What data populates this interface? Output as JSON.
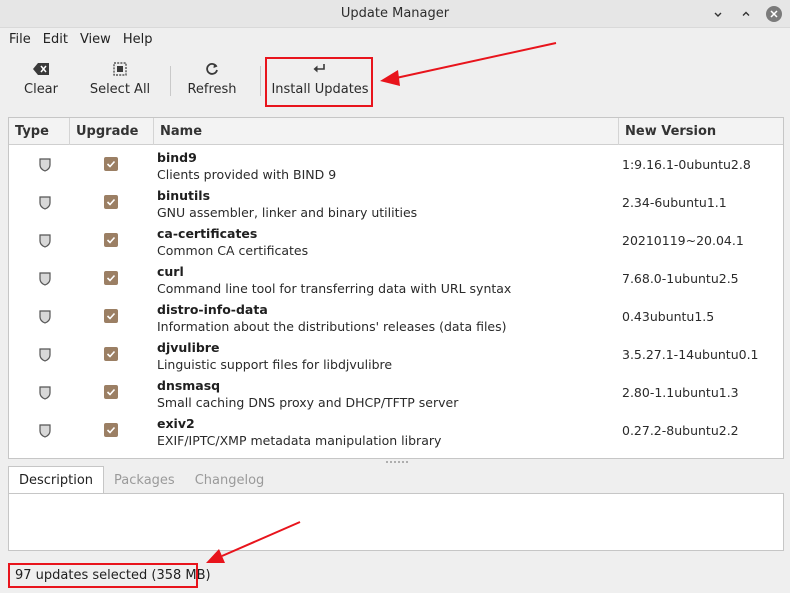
{
  "window": {
    "title": "Update Manager"
  },
  "menu": [
    "File",
    "Edit",
    "View",
    "Help"
  ],
  "toolbar": {
    "clear_label": "Clear",
    "select_all_label": "Select All",
    "refresh_label": "Refresh",
    "install_label": "Install Updates"
  },
  "table": {
    "columns": [
      "Type",
      "Upgrade",
      "Name",
      "New Version"
    ],
    "rows": [
      {
        "name": "bind9",
        "description": "Clients provided with BIND 9",
        "version": "1:9.16.1-0ubuntu2.8"
      },
      {
        "name": "binutils",
        "description": "GNU assembler, linker and binary utilities",
        "version": "2.34-6ubuntu1.1"
      },
      {
        "name": "ca-certificates",
        "description": "Common CA certificates",
        "version": "20210119~20.04.1"
      },
      {
        "name": "curl",
        "description": "Command line tool for transferring data with URL syntax",
        "version": "7.68.0-1ubuntu2.5"
      },
      {
        "name": "distro-info-data",
        "description": "Information about the distributions' releases (data files)",
        "version": "0.43ubuntu1.5"
      },
      {
        "name": "djvulibre",
        "description": "Linguistic support files for libdjvulibre",
        "version": "3.5.27.1-14ubuntu0.1"
      },
      {
        "name": "dnsmasq",
        "description": "Small caching DNS proxy and DHCP/TFTP server",
        "version": "2.80-1.1ubuntu1.3"
      },
      {
        "name": "exiv2",
        "description": "EXIF/IPTC/XMP metadata manipulation library",
        "version": "0.27.2-8ubuntu2.2"
      }
    ]
  },
  "tabs": [
    "Description",
    "Packages",
    "Changelog"
  ],
  "status": {
    "text": "97 updates selected (358 MB)"
  },
  "colors": {
    "annotation": "#e8141c",
    "checkbox": "#9b7f64"
  }
}
